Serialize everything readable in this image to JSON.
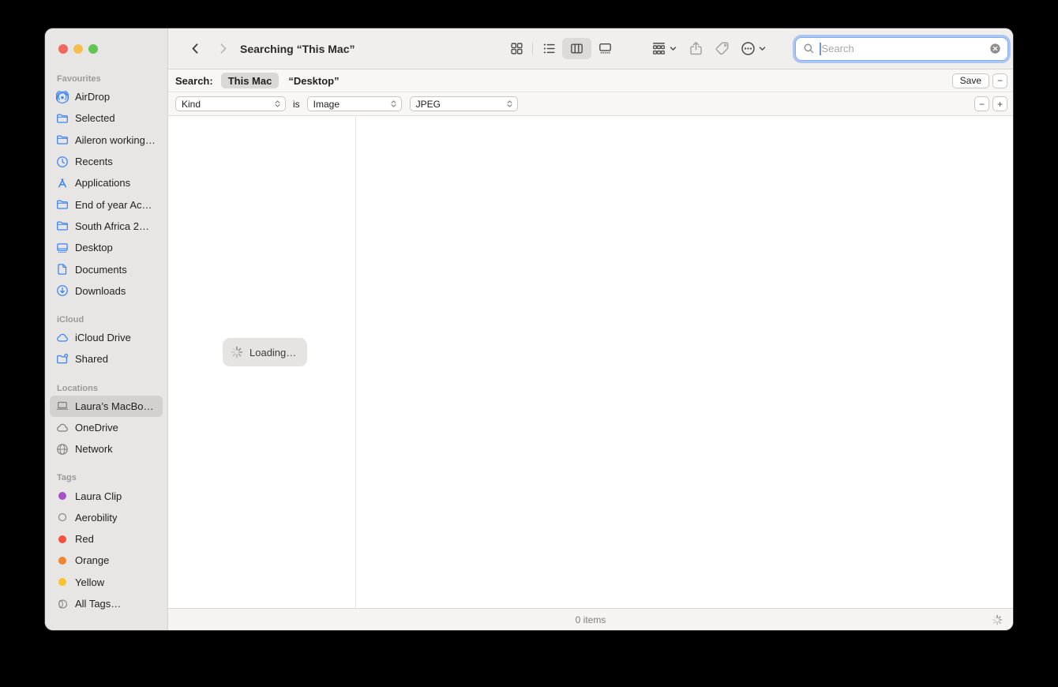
{
  "window": {
    "title": "Searching “This Mac”"
  },
  "colors": {
    "traffic_red": "#ee6a5f",
    "traffic_yellow": "#f5bf4f",
    "traffic_green": "#61c454",
    "focus_ring": "#84aef3",
    "sidebar_icon_blue": "#3c82f7",
    "selected_row": "#d2d1d0"
  },
  "toolbar": {
    "view_buttons": [
      {
        "name": "icons-view",
        "icon": "grid",
        "selected": false
      },
      {
        "name": "list-view",
        "icon": "list",
        "selected": false
      },
      {
        "name": "columns-view",
        "icon": "columns",
        "selected": true
      },
      {
        "name": "gallery-view",
        "icon": "gallery",
        "selected": false
      }
    ],
    "action_buttons": [
      {
        "name": "group-button",
        "icon": "group",
        "chevron": true,
        "muted": false
      },
      {
        "name": "share-button",
        "icon": "share",
        "chevron": false,
        "muted": true
      },
      {
        "name": "tags-button",
        "icon": "tag",
        "chevron": false,
        "muted": true
      },
      {
        "name": "more-button",
        "icon": "ellipsis",
        "chevron": true,
        "muted": false
      }
    ],
    "search": {
      "placeholder": "Search"
    }
  },
  "scope_bar": {
    "label": "Search:",
    "scopes": [
      {
        "label": "This Mac",
        "selected": true
      },
      {
        "label": "“Desktop”",
        "selected": false
      }
    ],
    "save_label": "Save",
    "remove_label": "−"
  },
  "filter_bar": {
    "attribute": "Kind",
    "conjunction": "is",
    "type": "Image",
    "subtype": "JPEG",
    "remove_label": "−",
    "add_label": "+"
  },
  "sidebar": {
    "sections": [
      {
        "title": "Favourites",
        "items": [
          {
            "label": "AirDrop",
            "icon": "airdrop"
          },
          {
            "label": "Selected",
            "icon": "folder"
          },
          {
            "label": "Aileron working…",
            "icon": "folder"
          },
          {
            "label": "Recents",
            "icon": "clock"
          },
          {
            "label": "Applications",
            "icon": "app-store"
          },
          {
            "label": "End of year Ac…",
            "icon": "folder"
          },
          {
            "label": "South Africa 2…",
            "icon": "folder"
          },
          {
            "label": "Desktop",
            "icon": "desktop"
          },
          {
            "label": "Documents",
            "icon": "document"
          },
          {
            "label": "Downloads",
            "icon": "download"
          }
        ]
      },
      {
        "title": "iCloud",
        "items": [
          {
            "label": "iCloud Drive",
            "icon": "cloud"
          },
          {
            "label": "Shared",
            "icon": "shared-folder"
          }
        ]
      },
      {
        "title": "Locations",
        "items": [
          {
            "label": "Laura’s MacBo…",
            "icon": "laptop",
            "gray": true,
            "selected": true
          },
          {
            "label": "OneDrive",
            "icon": "cloud",
            "gray": true
          },
          {
            "label": "Network",
            "icon": "globe",
            "gray": true
          }
        ]
      },
      {
        "title": "Tags",
        "items": [
          {
            "label": "Laura Clip",
            "icon": "tag-dot",
            "color": "#a550c9"
          },
          {
            "label": "Aerobility",
            "icon": "tag-dot-outline",
            "gray": true
          },
          {
            "label": "Red",
            "icon": "tag-dot",
            "color": "#f4513d"
          },
          {
            "label": "Orange",
            "icon": "tag-dot",
            "color": "#f1852f"
          },
          {
            "label": "Yellow",
            "icon": "tag-dot",
            "color": "#f8c32e"
          },
          {
            "label": "All Tags…",
            "icon": "all-tags",
            "gray": true
          }
        ]
      }
    ]
  },
  "content": {
    "loading_label": "Loading…"
  },
  "status_bar": {
    "count": "0 items"
  }
}
